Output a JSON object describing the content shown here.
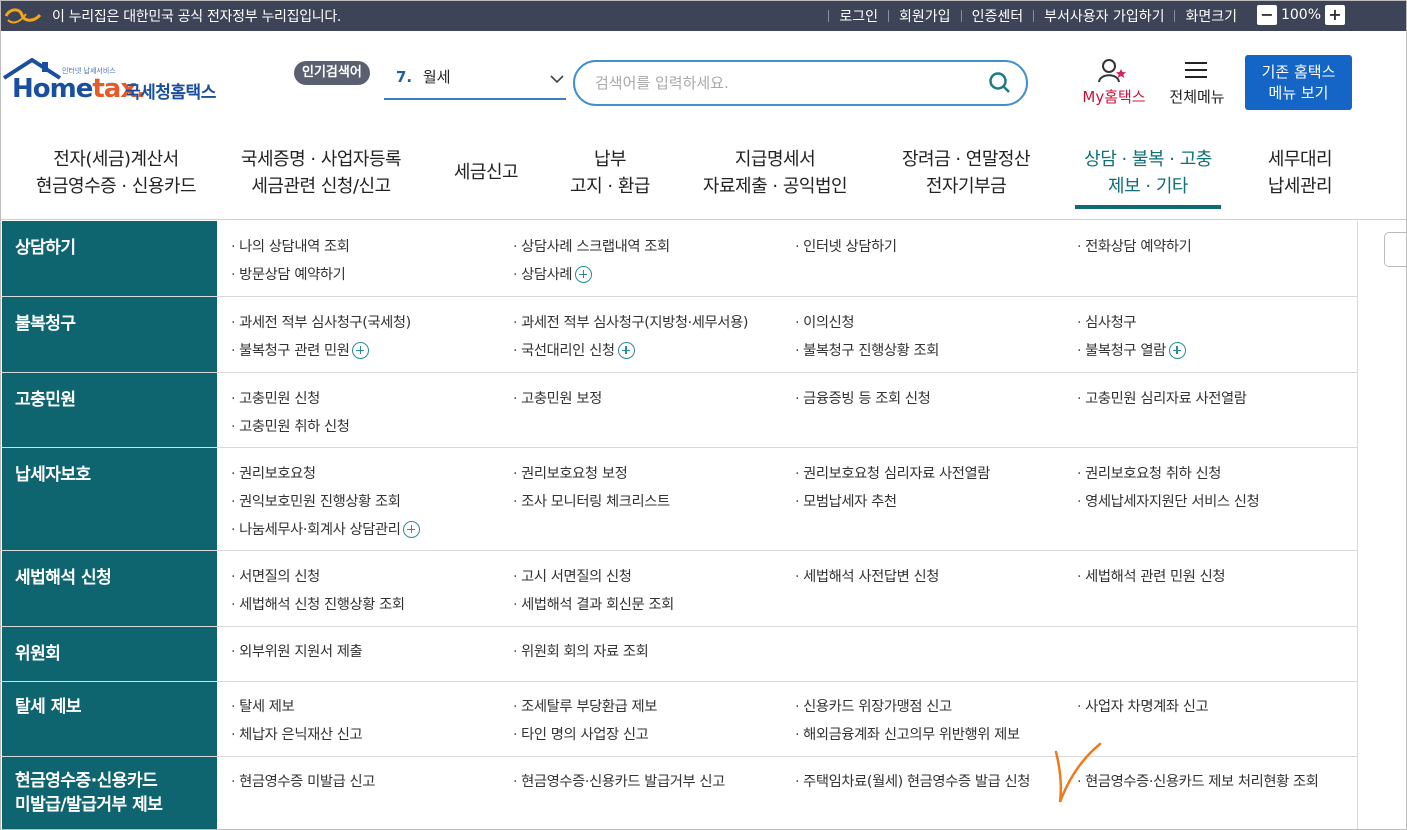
{
  "govbar": {
    "notice": "이 누리집은 대한민국 공식 전자정부 누리집입니다.",
    "links": [
      "로그인",
      "회원가입",
      "인증센터",
      "부서사용자 가입하기",
      "화면크기"
    ],
    "zoom": "100%",
    "zoom_minus": "−",
    "zoom_plus": "+"
  },
  "header": {
    "logo_brand_1": "Home",
    "logo_brand_2": "tax.",
    "logo_kname": "국세청홈택스",
    "logo_tiny": "인터넷 납세서비스",
    "popular_badge": "인기검색어",
    "popular_rank": "7.",
    "popular_word": "월세",
    "search_placeholder": "검색어를 입력하세요.",
    "my_hometax": "My홈택스",
    "all_menu": "전체메뉴",
    "old_menu_line1": "기존 홈택스",
    "old_menu_line2": "메뉴 보기"
  },
  "gnb": [
    {
      "line1": "전자(세금)계산서",
      "line2": "현금영수증 · 신용카드"
    },
    {
      "line1": "국세증명 · 사업자등록",
      "line2": "세금관련 신청/신고"
    },
    {
      "line1": "세금신고",
      "line2": ""
    },
    {
      "line1": "납부",
      "line2": "고지 · 환급"
    },
    {
      "line1": "지급명세서",
      "line2": "자료제출 · 공익법인"
    },
    {
      "line1": "장려금 · 연말정산",
      "line2": "전자기부금"
    },
    {
      "line1": "상담 · 불복 · 고충",
      "line2": "제보 · 기타"
    },
    {
      "line1": "세무대리",
      "line2": "납세관리"
    }
  ],
  "rows": [
    {
      "category": [
        "상담하기"
      ],
      "items": [
        [
          "나의 상담내역 조회",
          "상담사례 스크랩내역 조회",
          "인터넷 상담하기",
          "전화상담 예약하기"
        ],
        [
          "방문상담 예약하기",
          "상담사례",
          "",
          ""
        ]
      ]
    },
    {
      "category": [
        "불복청구"
      ],
      "items": [
        [
          "과세전 적부 심사청구(국세청)",
          "과세전 적부 심사청구(지방청·세무서용)",
          "이의신청",
          "심사청구"
        ],
        [
          "불복청구 관련 민원",
          "국선대리인 신청",
          "불복청구 진행상황 조회",
          "불복청구 열람"
        ]
      ]
    },
    {
      "category": [
        "고충민원"
      ],
      "items": [
        [
          "고충민원 신청",
          "고충민원 보정",
          "금융증빙 등 조회 신청",
          "고충민원 심리자료 사전열람"
        ],
        [
          "고충민원 취하 신청",
          "",
          "",
          ""
        ]
      ]
    },
    {
      "category": [
        "납세자보호"
      ],
      "items": [
        [
          "권리보호요청",
          "권리보호요청 보정",
          "권리보호요청 심리자료 사전열람",
          "권리보호요청 취하 신청"
        ],
        [
          "권익보호민원 진행상황 조회",
          "조사 모니터링 체크리스트",
          "모범납세자 추천",
          "영세납세자지원단 서비스 신청"
        ],
        [
          "나눔세무사·회계사 상담관리",
          "",
          "",
          ""
        ]
      ]
    },
    {
      "category": [
        "세법해석 신청"
      ],
      "items": [
        [
          "서면질의 신청",
          "고시 서면질의 신청",
          "세법해석 사전답변 신청",
          "세법해석 관련 민원 신청"
        ],
        [
          "세법해석 신청 진행상황 조회",
          "세법해석 결과 회신문 조회",
          "",
          ""
        ]
      ]
    },
    {
      "category": [
        "위원회"
      ],
      "items": [
        [
          "외부위원 지원서 제출",
          "위원회 회의 자료 조회",
          "",
          ""
        ]
      ]
    },
    {
      "category": [
        "탈세 제보"
      ],
      "items": [
        [
          "탈세 제보",
          "조세탈루 부당환급 제보",
          "신용카드 위장가맹점 신고",
          "사업자 차명계좌 신고"
        ],
        [
          "체납자 은닉재산 신고",
          "타인 명의 사업장 신고",
          "해외금융계좌 신고의무 위반행위 제보",
          ""
        ]
      ]
    },
    {
      "category": [
        "현금영수증·신용카드",
        "미발급/발급거부 제보"
      ],
      "items": [
        [
          "현금영수증 미발급 신고",
          "현금영수증·신용카드 발급거부 신고",
          "주택임차료(월세) 현금영수증 발급 신청",
          "현금영수증·신용카드 제보 처리현황 조회"
        ]
      ]
    }
  ],
  "colors": {
    "accent_teal": "#0e6570",
    "brand_blue": "#1565c6",
    "mytax_red": "#c8143c",
    "checkmark_orange": "#f07a1a"
  }
}
